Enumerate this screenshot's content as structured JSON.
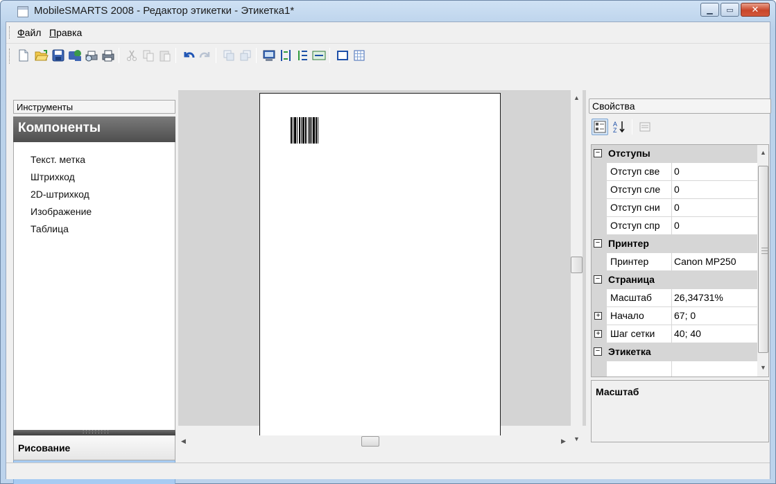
{
  "window": {
    "title": "MobileSMARTS 2008 - Редактор этикетки - Этикетка1*",
    "controls": [
      "minimize-icon",
      "maximize-icon",
      "close-icon"
    ]
  },
  "menu": {
    "file": {
      "underline": "Ф",
      "rest": "айл"
    },
    "edit": {
      "underline": "П",
      "rest": "равка"
    }
  },
  "toolbar": {
    "buttons": [
      "new-file-icon",
      "open-folder-icon",
      "save-icon",
      "save-all-icon",
      "print-preview-icon",
      "print-icon",
      "cut-icon",
      "copy-icon",
      "paste-icon",
      "undo-icon",
      "redo-icon",
      "bring-front-icon",
      "send-back-icon",
      "screen-icon",
      "align-height-icon",
      "align-vertical-icon",
      "align-width-icon",
      "rectangle-icon",
      "grid-icon"
    ]
  },
  "tools": {
    "header": "Инструменты",
    "group_title": "Компоненты",
    "items": [
      "Текст. метка",
      "Штрихкод",
      "2D-штрихкод",
      "Изображение",
      "Таблица"
    ],
    "nav": {
      "draw": "Рисование",
      "components": "Компоненты",
      "more": "»"
    }
  },
  "properties": {
    "header": "Свойства",
    "categories": [
      {
        "name": "Отступы",
        "props": [
          {
            "name": "Отступ све",
            "value": "0"
          },
          {
            "name": "Отступ сле",
            "value": "0"
          },
          {
            "name": "Отступ сни",
            "value": "0"
          },
          {
            "name": "Отступ спр",
            "value": "0"
          }
        ]
      },
      {
        "name": "Принтер",
        "props": [
          {
            "name": "Принтер",
            "value": "Canon MP250"
          }
        ]
      },
      {
        "name": "Страница",
        "props": [
          {
            "name": "Масштаб",
            "value": "26,34731%"
          },
          {
            "name": "Начало",
            "value": "67; 0",
            "expandable": true
          },
          {
            "name": "Шаг сетки",
            "value": "40; 40",
            "expandable": true
          }
        ]
      },
      {
        "name": "Этикетка",
        "props": []
      }
    ],
    "description_title": "Масштаб"
  },
  "colors": {
    "nav_selected": "#a7cbf2",
    "header_dark": "#4e4e4e",
    "category_bg": "#d6d6d6"
  }
}
